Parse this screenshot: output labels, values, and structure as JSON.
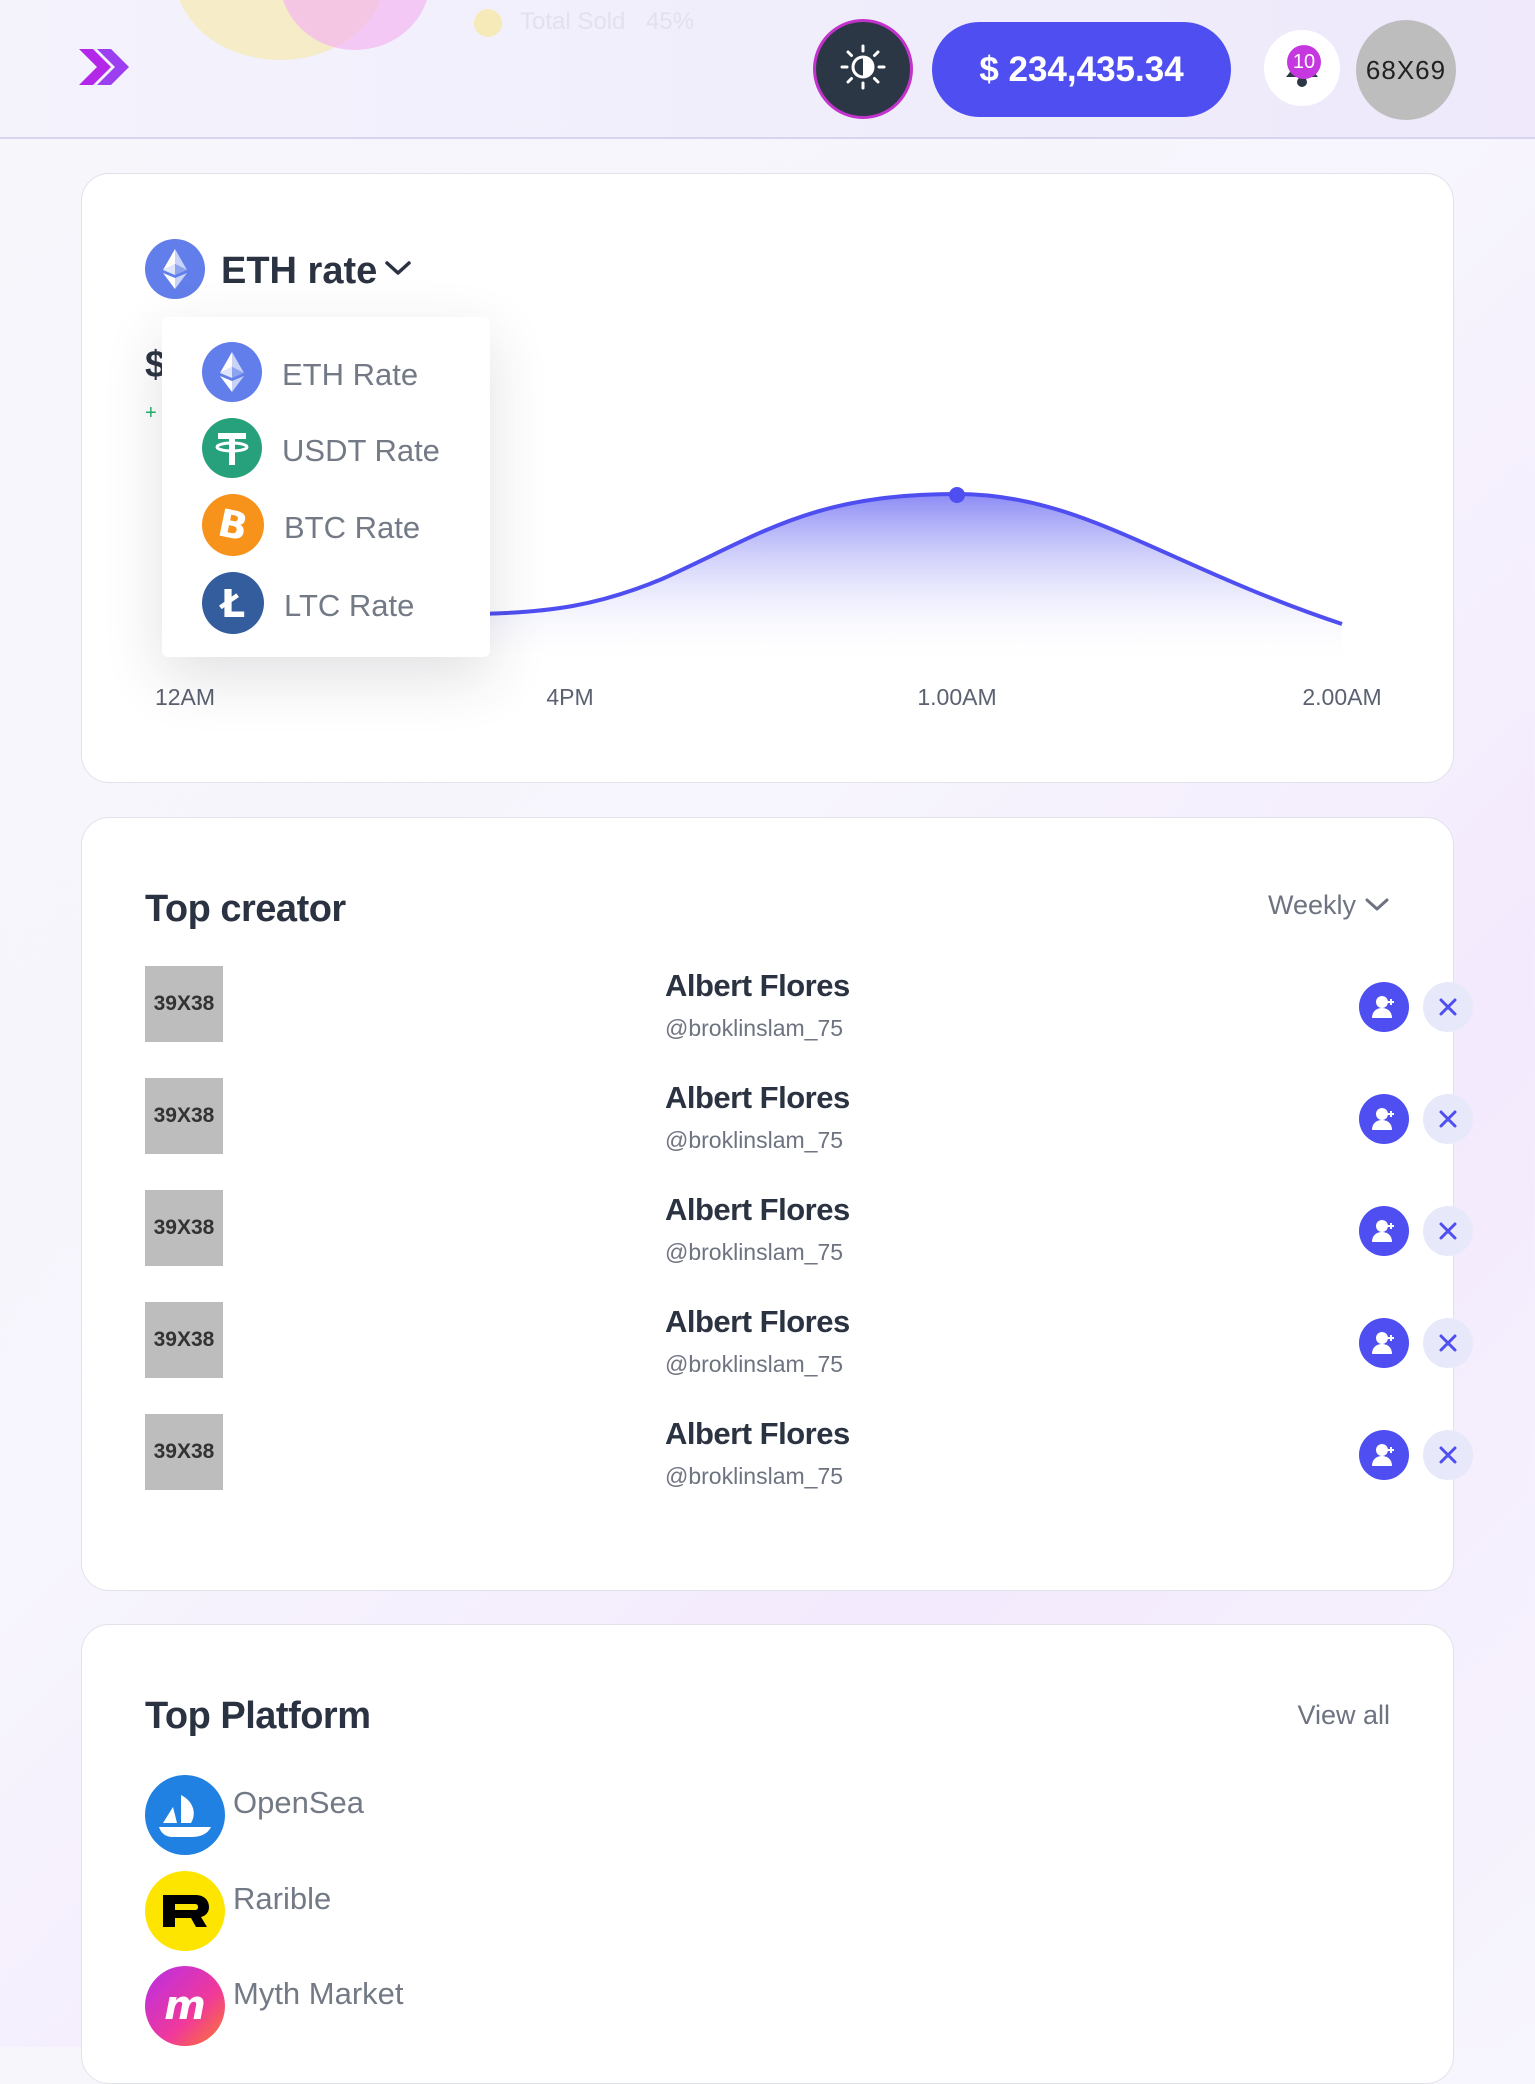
{
  "header": {
    "faded_label": "Total Sold",
    "faded_value": "45%",
    "balance": "$ 234,435.34",
    "notifications_count": "10",
    "avatar_placeholder": "68X69",
    "icons": [
      "double-chevron-icon",
      "sun-icon",
      "bell-icon"
    ]
  },
  "rate_card": {
    "title": "ETH rate",
    "value_prefix": "$",
    "change_prefix": "+",
    "dropdown": [
      {
        "label": "ETH Rate",
        "icon": "eth-icon",
        "color": "#627eea"
      },
      {
        "label": "USDT Rate",
        "icon": "usdt-icon",
        "color": "#26a17b"
      },
      {
        "label": "BTC Rate",
        "icon": "btc-icon",
        "color": "#f7931a"
      },
      {
        "label": "LTC Rate",
        "icon": "ltc-icon",
        "color": "#345d9d"
      }
    ]
  },
  "chart_data": {
    "type": "area",
    "x": [
      "12AM",
      "4PM",
      "1.00AM",
      "2.00AM"
    ],
    "tick_labels": [
      "12AM",
      "4PM",
      "1.00AM",
      "2.00AM"
    ],
    "highlighted_point": "1.00AM",
    "line_color": "#4f4ef0",
    "grid": false
  },
  "top_creator": {
    "title": "Top creator",
    "filter": "Weekly",
    "rows": [
      {
        "avatar": "39X38",
        "name": "Albert Flores",
        "handle": "@broklinslam_75"
      },
      {
        "avatar": "39X38",
        "name": "Albert Flores",
        "handle": "@broklinslam_75"
      },
      {
        "avatar": "39X38",
        "name": "Albert Flores",
        "handle": "@broklinslam_75"
      },
      {
        "avatar": "39X38",
        "name": "Albert Flores",
        "handle": "@broklinslam_75"
      },
      {
        "avatar": "39X38",
        "name": "Albert Flores",
        "handle": "@broklinslam_75"
      }
    ]
  },
  "top_platform": {
    "title": "Top Platform",
    "view_all": "View all",
    "items": [
      {
        "name": "OpenSea",
        "icon": "opensea-icon",
        "color": "#2081e2"
      },
      {
        "name": "Rarible",
        "icon": "rarible-icon",
        "color": "#fde500"
      },
      {
        "name": "Myth Market",
        "icon": "myth-market-icon",
        "color": "#e8399a"
      }
    ]
  },
  "colors": {
    "accent": "#4f4ef0",
    "text_dark": "#2b3342",
    "text_muted": "#6d7380"
  }
}
